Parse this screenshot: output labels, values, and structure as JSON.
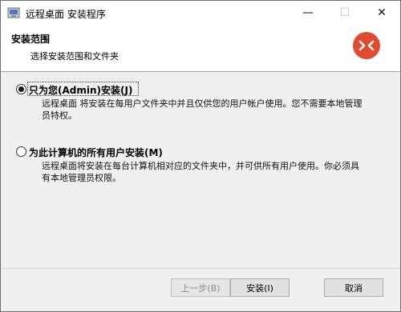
{
  "window": {
    "title": "远程桌面 安装程序",
    "controls": {
      "minimize": "—",
      "maximize": "☐",
      "close": "✕"
    }
  },
  "banner": {
    "title": "安装范围",
    "subtitle": "选择安装范围和文件夹",
    "logo_color": "#e04a2f"
  },
  "options": [
    {
      "label": "只为您(Admin)安装(J)",
      "description": "远程桌面 将安装在每用户文件夹中并且仅供您的用户帐户使用。您不需要本地管理员特权。",
      "selected": true
    },
    {
      "label": "为此计算机的所有用户安装(M)",
      "description": "远程桌面将安装在每台计算机相对应的文件夹中，并可供所有用户使用。你必须具有本地管理员权限。",
      "selected": false
    }
  ],
  "footer": {
    "back_label": "上一步(B)",
    "install_label": "安装(I)",
    "cancel_label": "取消"
  }
}
